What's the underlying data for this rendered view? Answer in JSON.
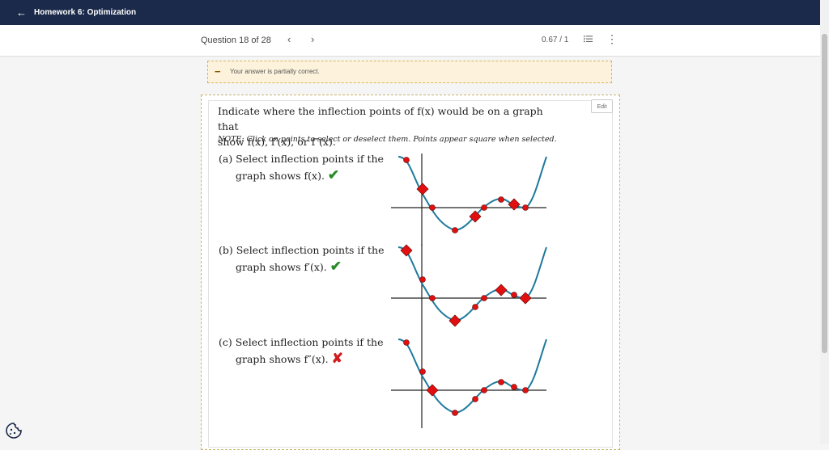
{
  "header": {
    "title": "Homework 6: Optimization",
    "back_icon": "arrow-left-icon"
  },
  "nav": {
    "question_counter": "Question 18 of 28",
    "prev_symbol": "‹",
    "next_symbol": "›",
    "score": "0.67 / 1",
    "more_symbol": "⋮"
  },
  "feedback": {
    "symbol": "−",
    "text": "Your answer is partially correct."
  },
  "question": {
    "edit_label": "Edit",
    "prompt_line1": "Indicate where the inflection points of f(x) would be on a graph that",
    "prompt_line2": "show  f(x), f′(x), or f″(x).",
    "note": "NOTE: Click on points to select or deselect them. Points appear square when selected.",
    "parts": [
      {
        "label_line1": "(a) Select inflection points if the",
        "label_line2": "graph shows f(x).",
        "mark": "✔",
        "correct": true
      },
      {
        "label_line1": "(b) Select inflection points if the",
        "label_line2": "graph shows f′(x).",
        "mark": "✔",
        "correct": true
      },
      {
        "label_line1": "(c) Select inflection points if the",
        "label_line2": "graph shows f″(x).",
        "mark": "✘",
        "correct": false
      }
    ]
  },
  "graphs": [
    {
      "selected": [
        false,
        true,
        false,
        false,
        true,
        false,
        false,
        true,
        false
      ]
    },
    {
      "selected": [
        true,
        false,
        false,
        true,
        false,
        false,
        true,
        false,
        true
      ]
    },
    {
      "selected": [
        false,
        false,
        true,
        false,
        false,
        false,
        false,
        false,
        false
      ]
    }
  ],
  "colors": {
    "header_bg": "#1b2a4a",
    "curve": "#1f7a9c",
    "point": "#e01010",
    "correct": "#2a8a2a",
    "incorrect": "#d21c1c",
    "alert_bg": "#fdf3dc"
  }
}
